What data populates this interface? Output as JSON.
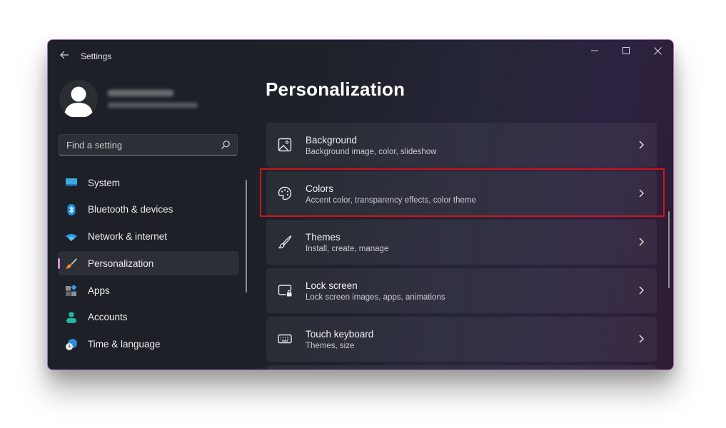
{
  "window": {
    "title": "Settings",
    "controls": {
      "minimize": "minimize",
      "maximize": "maximize",
      "close": "close"
    }
  },
  "profile": {
    "name": "(blurred)",
    "email": "(blurred)"
  },
  "search": {
    "placeholder": "Find a setting",
    "value": ""
  },
  "sidebar": {
    "items": [
      {
        "label": "System",
        "icon": "monitor-icon",
        "active": false
      },
      {
        "label": "Bluetooth & devices",
        "icon": "bluetooth-icon",
        "active": false
      },
      {
        "label": "Network & internet",
        "icon": "wifi-icon",
        "active": false
      },
      {
        "label": "Personalization",
        "icon": "paintbrush-icon",
        "active": true
      },
      {
        "label": "Apps",
        "icon": "apps-icon",
        "active": false
      },
      {
        "label": "Accounts",
        "icon": "person-icon",
        "active": false
      },
      {
        "label": "Time & language",
        "icon": "clock-globe-icon",
        "active": false
      }
    ]
  },
  "main": {
    "title": "Personalization",
    "cards": [
      {
        "title": "Background",
        "subtitle": "Background image, color, slideshow",
        "icon": "image-icon"
      },
      {
        "title": "Colors",
        "subtitle": "Accent color, transparency effects, color theme",
        "icon": "palette-icon",
        "highlighted": true
      },
      {
        "title": "Themes",
        "subtitle": "Install, create, manage",
        "icon": "brush-icon"
      },
      {
        "title": "Lock screen",
        "subtitle": "Lock screen images, apps, animations",
        "icon": "lock-screen-icon"
      },
      {
        "title": "Touch keyboard",
        "subtitle": "Themes, size",
        "icon": "keyboard-icon"
      }
    ]
  },
  "colors": {
    "highlight_border": "#d0151c",
    "active_indicator": "#d48fe0"
  }
}
